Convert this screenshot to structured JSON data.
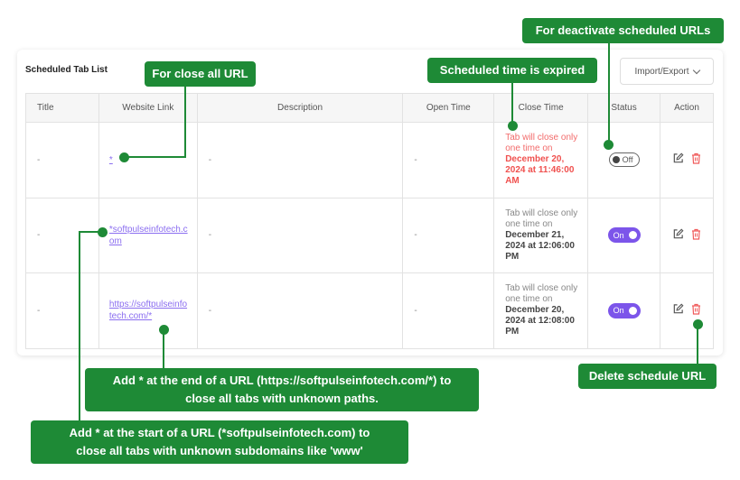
{
  "panel": {
    "title": "Scheduled Tab List",
    "import_export_label": "Import/Export"
  },
  "table": {
    "headers": {
      "title": "Title",
      "website_link": "Website Link",
      "description": "Description",
      "open_time": "Open Time",
      "close_time": "Close Time",
      "status": "Status",
      "action": "Action"
    },
    "rows": [
      {
        "title": "-",
        "website_link": "*",
        "description": "-",
        "open_time": "-",
        "close_prefix": "Tab will close only one time on",
        "close_date": "December 20, 2024 at 11:46:00 AM",
        "expired": true,
        "status_label": "Off",
        "status_on": false
      },
      {
        "title": "-",
        "website_link": "*softpulseinfotech.com",
        "description": "-",
        "open_time": "-",
        "close_prefix": "Tab will close only one time on",
        "close_date": "December 21, 2024 at 12:06:00 PM",
        "expired": false,
        "status_label": "On",
        "status_on": true
      },
      {
        "title": "-",
        "website_link": "https://softpulseinfotech.com/*",
        "description": "-",
        "open_time": "-",
        "close_prefix": "Tab will close only one time on",
        "close_date": "December 20, 2024 at 12:08:00 PM",
        "expired": false,
        "status_label": "On",
        "status_on": true
      }
    ]
  },
  "callouts": {
    "close_all": "For close all URL",
    "expired": "Scheduled time is expired",
    "deactivate": "For deactivate scheduled URLs",
    "delete": "Delete schedule URL",
    "end_wildcard_line1": "Add * at the end of a URL (https://softpulseinfotech.com/*) to",
    "end_wildcard_line2": "close all tabs with unknown paths.",
    "start_wildcard_line1": "Add * at the start of a URL (*softpulseinfotech.com) to",
    "start_wildcard_line2": "close all tabs with unknown subdomains like 'www'"
  },
  "colors": {
    "callout_green": "#1e8a36",
    "toggle_on": "#7c55ea",
    "link": "#8b6ef0",
    "expired_red": "#f0514f",
    "delete_red": "#f05a5a"
  }
}
